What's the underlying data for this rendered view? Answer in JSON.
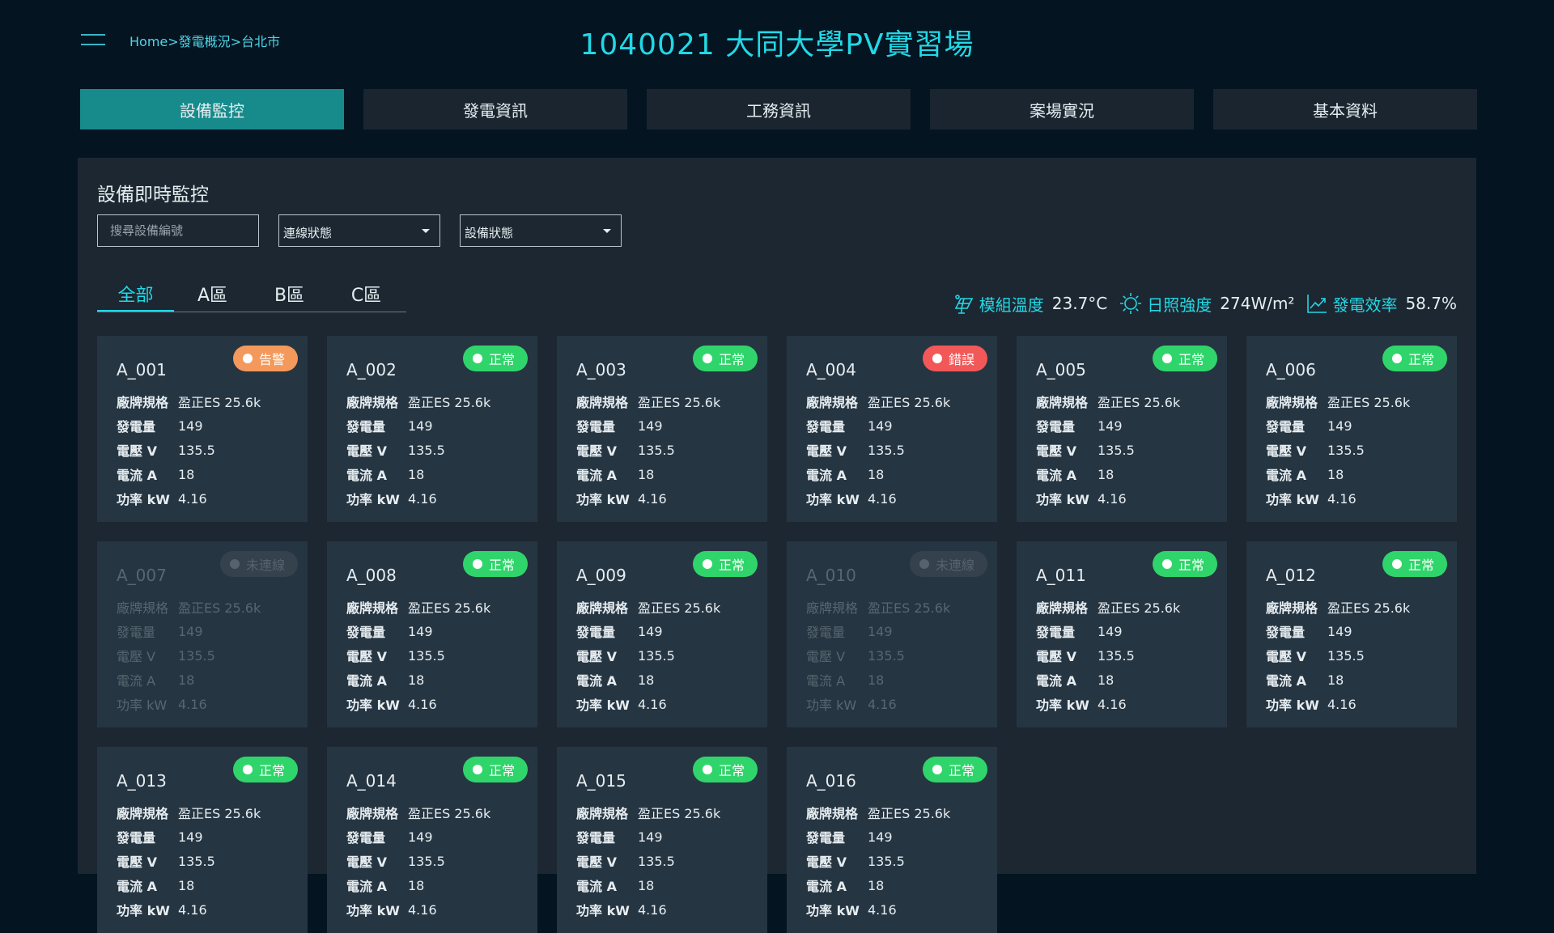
{
  "breadcrumb": [
    "Home",
    "發電概況",
    "台北市"
  ],
  "breadcrumb_sep": ">",
  "page_title": "1040021 大同大學PV實習場",
  "nav_tabs": [
    {
      "label": "設備監控",
      "active": true
    },
    {
      "label": "發電資訊",
      "active": false
    },
    {
      "label": "工務資訊",
      "active": false
    },
    {
      "label": "案場實況",
      "active": false
    },
    {
      "label": "基本資料",
      "active": false
    }
  ],
  "section_title": "設備即時監控",
  "filters": {
    "search_placeholder": "搜尋設備編號",
    "connection_select": "連線狀態",
    "device_select": "設備狀態"
  },
  "area_tabs": [
    {
      "label": "全部",
      "active": true
    },
    {
      "label": "A區",
      "active": false
    },
    {
      "label": "B區",
      "active": false
    },
    {
      "label": "C區",
      "active": false
    }
  ],
  "metrics": [
    {
      "icon": "solar-panel-temp-icon",
      "label": "模組溫度",
      "value": "23.7°C"
    },
    {
      "icon": "sun-icon",
      "label": "日照強度",
      "value": "274W/m²"
    },
    {
      "icon": "trend-chart-icon",
      "label": "發電效率",
      "value": "58.7%"
    }
  ],
  "field_labels": [
    "廠牌規格",
    "發電量",
    "電壓 V",
    "電流 A",
    "功率 kW"
  ],
  "status_colors": {
    "normal": "#2fd56a",
    "warning": "#f3995b",
    "error": "#f25858",
    "offline": "#35424d",
    "accent": "#22d8e6"
  },
  "devices": [
    {
      "id": "A_001",
      "status": "告警",
      "status_type": "warning",
      "values": [
        "盈正ES 25.6k",
        "149",
        "135.5",
        "18",
        "4.16"
      ]
    },
    {
      "id": "A_002",
      "status": "正常",
      "status_type": "normal",
      "values": [
        "盈正ES 25.6k",
        "149",
        "135.5",
        "18",
        "4.16"
      ]
    },
    {
      "id": "A_003",
      "status": "正常",
      "status_type": "normal",
      "values": [
        "盈正ES 25.6k",
        "149",
        "135.5",
        "18",
        "4.16"
      ]
    },
    {
      "id": "A_004",
      "status": "錯誤",
      "status_type": "error",
      "values": [
        "盈正ES 25.6k",
        "149",
        "135.5",
        "18",
        "4.16"
      ]
    },
    {
      "id": "A_005",
      "status": "正常",
      "status_type": "normal",
      "values": [
        "盈正ES 25.6k",
        "149",
        "135.5",
        "18",
        "4.16"
      ]
    },
    {
      "id": "A_006",
      "status": "正常",
      "status_type": "normal",
      "values": [
        "盈正ES 25.6k",
        "149",
        "135.5",
        "18",
        "4.16"
      ]
    },
    {
      "id": "A_007",
      "status": "未連線",
      "status_type": "offline",
      "values": [
        "盈正ES 25.6k",
        "149",
        "135.5",
        "18",
        "4.16"
      ]
    },
    {
      "id": "A_008",
      "status": "正常",
      "status_type": "normal",
      "values": [
        "盈正ES 25.6k",
        "149",
        "135.5",
        "18",
        "4.16"
      ]
    },
    {
      "id": "A_009",
      "status": "正常",
      "status_type": "normal",
      "values": [
        "盈正ES 25.6k",
        "149",
        "135.5",
        "18",
        "4.16"
      ]
    },
    {
      "id": "A_010",
      "status": "未連線",
      "status_type": "offline",
      "values": [
        "盈正ES 25.6k",
        "149",
        "135.5",
        "18",
        "4.16"
      ]
    },
    {
      "id": "A_011",
      "status": "正常",
      "status_type": "normal",
      "values": [
        "盈正ES 25.6k",
        "149",
        "135.5",
        "18",
        "4.16"
      ]
    },
    {
      "id": "A_012",
      "status": "正常",
      "status_type": "normal",
      "values": [
        "盈正ES 25.6k",
        "149",
        "135.5",
        "18",
        "4.16"
      ]
    },
    {
      "id": "A_013",
      "status": "正常",
      "status_type": "normal",
      "values": [
        "盈正ES 25.6k",
        "149",
        "135.5",
        "18",
        "4.16"
      ]
    },
    {
      "id": "A_014",
      "status": "正常",
      "status_type": "normal",
      "values": [
        "盈正ES 25.6k",
        "149",
        "135.5",
        "18",
        "4.16"
      ]
    },
    {
      "id": "A_015",
      "status": "正常",
      "status_type": "normal",
      "values": [
        "盈正ES 25.6k",
        "149",
        "135.5",
        "18",
        "4.16"
      ]
    },
    {
      "id": "A_016",
      "status": "正常",
      "status_type": "normal",
      "values": [
        "盈正ES 25.6k",
        "149",
        "135.5",
        "18",
        "4.16"
      ]
    }
  ]
}
